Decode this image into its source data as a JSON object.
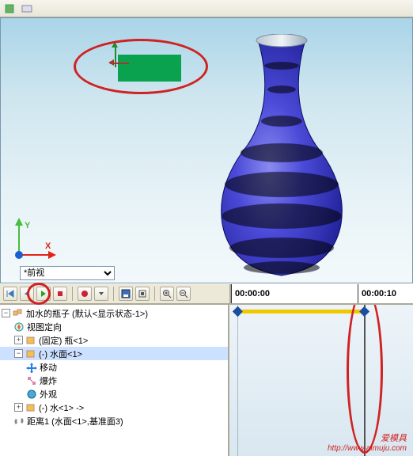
{
  "viewport": {
    "view_dropdown": "*前视",
    "axes": {
      "x": "X",
      "y": "Y"
    }
  },
  "toolbar": {
    "play_tooltip": "Play",
    "time_header": [
      "00:00:00",
      "00:00:10"
    ]
  },
  "tree": {
    "root": "加水的瓶子  (默认<显示状态-1>)",
    "items": [
      {
        "label": "视图定向",
        "icon": "compass-icon"
      },
      {
        "label": "(固定) 瓶<1>",
        "icon": "part-icon"
      },
      {
        "label": "(-) 水面<1>",
        "icon": "part-icon",
        "selected": true
      },
      {
        "label": "移动",
        "icon": "move-icon"
      },
      {
        "label": "爆炸",
        "icon": "explode-icon"
      },
      {
        "label": "外观",
        "icon": "appearance-icon"
      },
      {
        "label": "(-) 水<1> ->",
        "icon": "part-icon"
      },
      {
        "label": "距离1 (水面<1>,基准面3)",
        "icon": "mate-icon"
      }
    ]
  },
  "watermark": {
    "main": "爱模具",
    "sub": "http://www.aimuju.com"
  }
}
